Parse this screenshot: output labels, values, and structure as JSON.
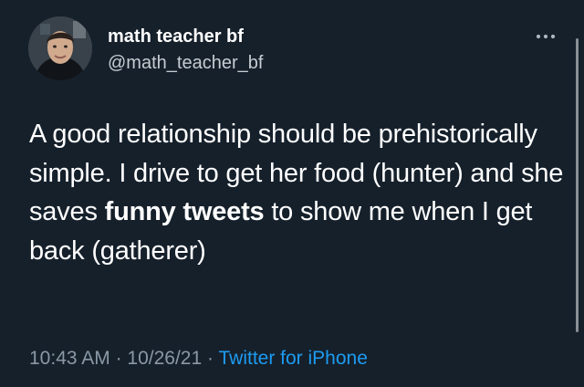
{
  "author": {
    "display_name": "math teacher bf",
    "handle": "@math_teacher_bf",
    "avatar_icon": "profile-photo"
  },
  "tweet": {
    "segments": [
      {
        "text": "A good relationship should be prehistorically simple. I drive to get her food (hunter) and she saves ",
        "bold": false
      },
      {
        "text": "funny tweets",
        "bold": true
      },
      {
        "text": " to show me when I get back (gatherer)",
        "bold": false
      }
    ]
  },
  "meta": {
    "time": "10:43 AM",
    "separator": "·",
    "date": "10/26/21",
    "source": "Twitter for iPhone"
  },
  "colors": {
    "background": "#15202b",
    "text": "#ffffff",
    "secondary_text": "#8b98a5",
    "link": "#1d9bf0"
  },
  "icons": {
    "more": "more-horizontal-icon"
  }
}
